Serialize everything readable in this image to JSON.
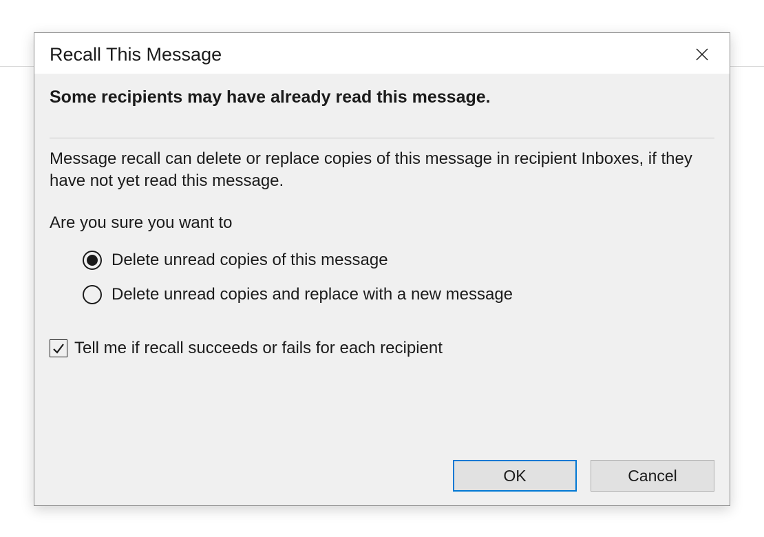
{
  "dialog": {
    "title": "Recall This Message",
    "heading": "Some recipients may have already read this message.",
    "description": "Message recall can delete or replace copies of this message in recipient Inboxes, if they have not yet read this message.",
    "prompt": "Are you sure you want to",
    "options": [
      {
        "label": "Delete unread copies of this message",
        "selected": true
      },
      {
        "label": "Delete unread copies and replace with a new message",
        "selected": false
      }
    ],
    "checkbox": {
      "label": "Tell me if recall succeeds or fails for each recipient",
      "checked": true
    },
    "buttons": {
      "ok": "OK",
      "cancel": "Cancel"
    }
  }
}
